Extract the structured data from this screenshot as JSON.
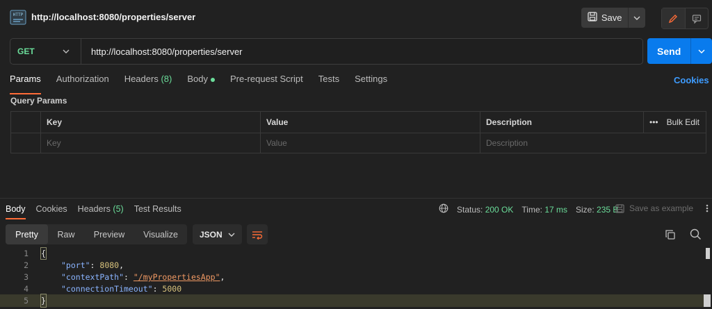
{
  "header": {
    "title": "http://localhost:8080/properties/server",
    "save_label": "Save"
  },
  "request": {
    "method": "GET",
    "url": "http://localhost:8080/properties/server",
    "send_label": "Send",
    "tabs": [
      "Params",
      "Authorization",
      "Headers",
      "Body",
      "Pre-request Script",
      "Tests",
      "Settings"
    ],
    "headers_count": "(8)",
    "cookies_label": "Cookies"
  },
  "query_params": {
    "section_label": "Query Params",
    "columns": [
      "Key",
      "Value",
      "Description"
    ],
    "bulk_edit_label": "Bulk Edit",
    "placeholders": [
      "Key",
      "Value",
      "Description"
    ]
  },
  "response": {
    "tabs": [
      "Body",
      "Cookies",
      "Headers",
      "Test Results"
    ],
    "headers_count": "(5)",
    "status_label": "Status:",
    "status_value": "200 OK",
    "time_label": "Time:",
    "time_value": "17 ms",
    "size_label": "Size:",
    "size_value": "235 B",
    "save_example_label": "Save as example",
    "format_tabs": [
      "Pretty",
      "Raw",
      "Preview",
      "Visualize"
    ],
    "format_select": "JSON",
    "code_lines": [
      {
        "num": "1",
        "text": "{"
      },
      {
        "num": "2",
        "key": "\"port\"",
        "value": "8080",
        "type": "number",
        "trail": ","
      },
      {
        "num": "3",
        "key": "\"contextPath\"",
        "value": "\"/myPropertiesApp\"",
        "type": "string",
        "trail": ","
      },
      {
        "num": "4",
        "key": "\"connectionTimeout\"",
        "value": "5000",
        "type": "number",
        "trail": ""
      },
      {
        "num": "5",
        "text": "}"
      }
    ]
  },
  "colors": {
    "accent_orange": "#ff6c37",
    "send_blue": "#097bed",
    "success_green": "#6bdd9a",
    "link_blue": "#3e9cff"
  }
}
